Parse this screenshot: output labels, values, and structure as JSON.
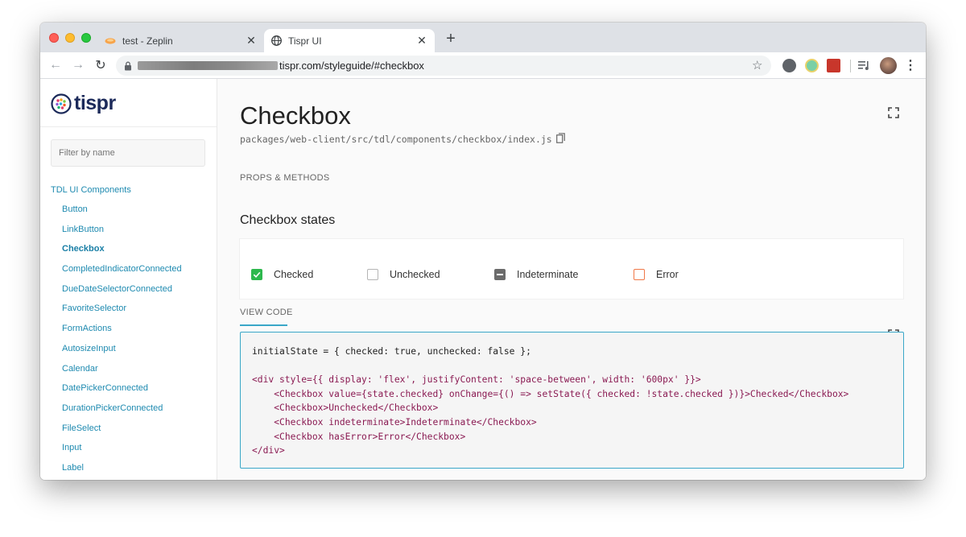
{
  "browser": {
    "tabs": [
      {
        "title": "test - Zeplin",
        "active": false
      },
      {
        "title": "Tispr UI",
        "active": true
      }
    ],
    "close_glyph": "✕",
    "new_tab_glyph": "+",
    "url": "tispr.com/styleguide/#checkbox",
    "back_icon": "←",
    "forward_icon": "→",
    "reload_icon": "↻",
    "star_icon": "☆",
    "menu_icon": "⋮"
  },
  "sidebar": {
    "logo_text": "tispr",
    "filter_placeholder": "Filter by name",
    "section": "TDL UI Components",
    "items": [
      {
        "label": "Button"
      },
      {
        "label": "LinkButton"
      },
      {
        "label": "Checkbox",
        "active": true
      },
      {
        "label": "CompletedIndicatorConnected"
      },
      {
        "label": "DueDateSelectorConnected"
      },
      {
        "label": "FavoriteSelector"
      },
      {
        "label": "FormActions"
      },
      {
        "label": "AutosizeInput"
      },
      {
        "label": "Calendar"
      },
      {
        "label": "DatePickerConnected"
      },
      {
        "label": "DurationPickerConnected"
      },
      {
        "label": "FileSelect"
      },
      {
        "label": "Input"
      },
      {
        "label": "Label"
      }
    ]
  },
  "main": {
    "title": "Checkbox",
    "path": "packages/web-client/src/tdl/components/checkbox/index.js",
    "props_link": "PROPS & METHODS",
    "states_title": "Checkbox states",
    "checkboxes": [
      {
        "label": "Checked",
        "state": "checked"
      },
      {
        "label": "Unchecked",
        "state": "unchecked"
      },
      {
        "label": "Indeterminate",
        "state": "indeterminate"
      },
      {
        "label": "Error",
        "state": "error"
      }
    ],
    "view_code": "VIEW CODE",
    "code": {
      "line1": "initialState = { checked: true, unchecked: false };",
      "line3": "<div style={{ display: 'flex', justifyContent: 'space-between', width: '600px' }}>",
      "line4": "<Checkbox value={state.checked} onChange={() => setState({ checked: !state.checked })}>Checked</Checkbox>",
      "line5": "<Checkbox>Unchecked</Checkbox>",
      "line6": "<Checkbox indeterminate>Indeterminate</Checkbox>",
      "line7": "<Checkbox hasError>Error</Checkbox>",
      "line8": "</div>"
    }
  },
  "colors": {
    "accent": "#1e8ab0",
    "checked": "#2db84d",
    "indeterminate": "#6b6b6b",
    "error": "#f07848",
    "code_border": "#3aa7c8"
  }
}
